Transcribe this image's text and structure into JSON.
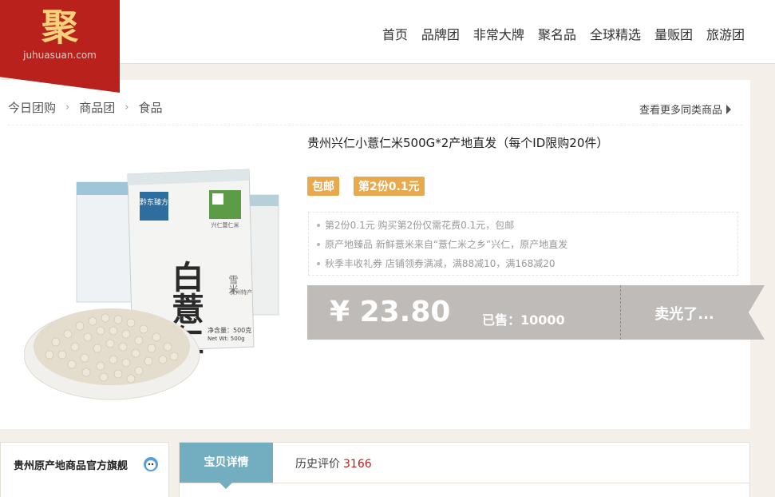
{
  "logo": {
    "char": "聚",
    "url": "juhuasuan.com"
  },
  "nav": [
    "首页",
    "品牌团",
    "非常大牌",
    "聚名品",
    "全球精选",
    "量贩团",
    "旅游团"
  ],
  "breadcrumb": [
    "今日团购",
    "商品团",
    "食品"
  ],
  "more_link": "查看更多同类商品",
  "product": {
    "title": "贵州兴仁小薏仁米500G*2产地直发（每个ID限购20件）",
    "badges": [
      "包邮",
      "第2份0.1元"
    ],
    "promotions": [
      "第2份0.1元 购买第2份仅需花费0.1元，包邮",
      "原产地臻品 新鲜薏米来自“薏仁米之乡”兴仁，原产地直发",
      "秋季丰收礼券 店铺领券满减，满88减10，满168减20"
    ],
    "price": "¥ 23.80",
    "sold": "已售：10000",
    "status_button": "卖光了...",
    "package_text": {
      "big": "白薏仁",
      "brand": "黔东臻方",
      "side": "雪米",
      "sub": "贵州特产",
      "net": "净含量：500克",
      "net_en": "Net Wt: 500g",
      "seal": "兴仁薏仁米"
    }
  },
  "shop": {
    "name": "贵州原产地商品官方旗舰"
  },
  "tabs": {
    "details": "宝贝详情",
    "history_label": "历史评价",
    "history_count": "3166"
  },
  "colors": {
    "brand_red": "#b8211c",
    "badge_orange": "#e7a94c",
    "price_gray": "#bebbb8",
    "tab_blue": "#73adc0",
    "logo_gold": "#f6d27a"
  }
}
